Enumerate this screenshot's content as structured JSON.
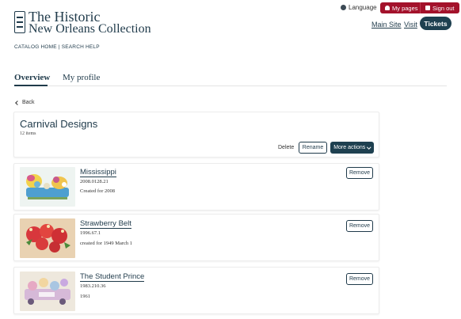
{
  "brand": {
    "line1": "The Historic",
    "line2": "New Orleans Collection"
  },
  "header": {
    "language": "Language",
    "my_pages": "My pages",
    "sign_out": "Sign out",
    "main_site": "Main Site",
    "visit": "Visit",
    "tickets": "Tickets"
  },
  "catalog_links": "CATALOG HOME | SEARCH HELP",
  "tabs": [
    {
      "label": "Overview",
      "active": true
    },
    {
      "label": "My profile",
      "active": false
    }
  ],
  "back": "Back",
  "list": {
    "title": "Carnival Designs",
    "count": "12 items",
    "actions": {
      "delete": "Delete",
      "rename": "Rename",
      "more": "More actions"
    }
  },
  "items": [
    {
      "title": "Mississippi",
      "id": "2008.0128.21",
      "note": "Created for 2008",
      "remove": "Remove"
    },
    {
      "title": "Strawberry Belt",
      "id": "1996.67.1",
      "note": "created for 1949 March 1",
      "remove": "Remove"
    },
    {
      "title": "The Student Prince",
      "id": "1983.210.36",
      "note": "1961",
      "remove": "Remove"
    }
  ],
  "colors": {
    "accent_dark": "#1e4050",
    "accent_red": "#a3122b",
    "text": "#1f3a4a"
  },
  "icons": [
    "logo-mark-icon",
    "globe-icon",
    "person-icon",
    "signout-icon",
    "chevron-left-icon",
    "chevron-down-icon"
  ]
}
